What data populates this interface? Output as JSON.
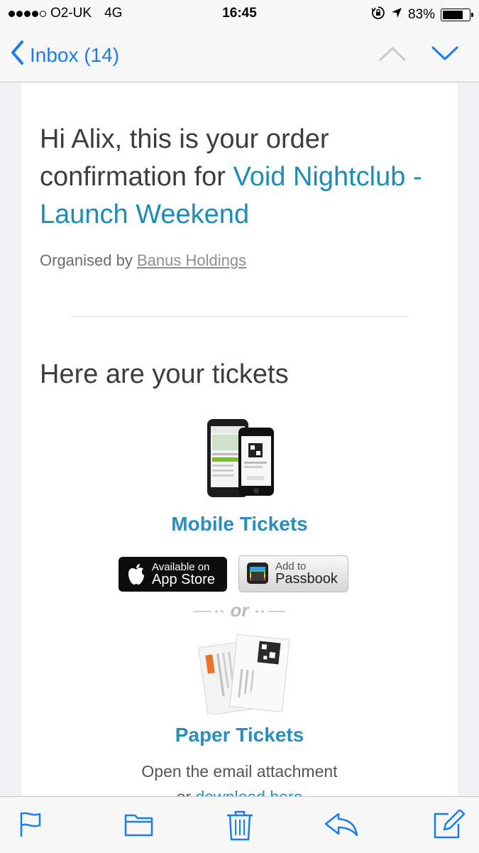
{
  "status_bar": {
    "carrier": "O2-UK",
    "network": "4G",
    "time": "16:45",
    "battery": "83%",
    "battery_level": 0.83
  },
  "nav": {
    "back_label": "Inbox (14)"
  },
  "email": {
    "greeting_prefix": "Hi Alix, this is your order confirmation for ",
    "event_name": "Void Nightclub - Launch Weekend",
    "organised_by_label": "Organised by ",
    "organiser": "Banus Holdings",
    "tickets_heading": "Here are your tickets",
    "mobile_tickets_title": "Mobile Tickets",
    "app_store_small": "Available on",
    "app_store_big": "App Store",
    "passbook_small": "Add to",
    "passbook_big": "Passbook",
    "or_text": "or",
    "paper_tickets_title": "Paper Tickets",
    "paper_line1": "Open the email attachment",
    "paper_line2_prefix": "or ",
    "paper_line2_link": "download here"
  },
  "colors": {
    "ios_blue": "#1a7cf1",
    "link_teal": "#1d8cb8"
  },
  "toolbar": {
    "icons": [
      "flag-icon",
      "folder-icon",
      "trash-icon",
      "reply-icon",
      "compose-icon"
    ]
  }
}
